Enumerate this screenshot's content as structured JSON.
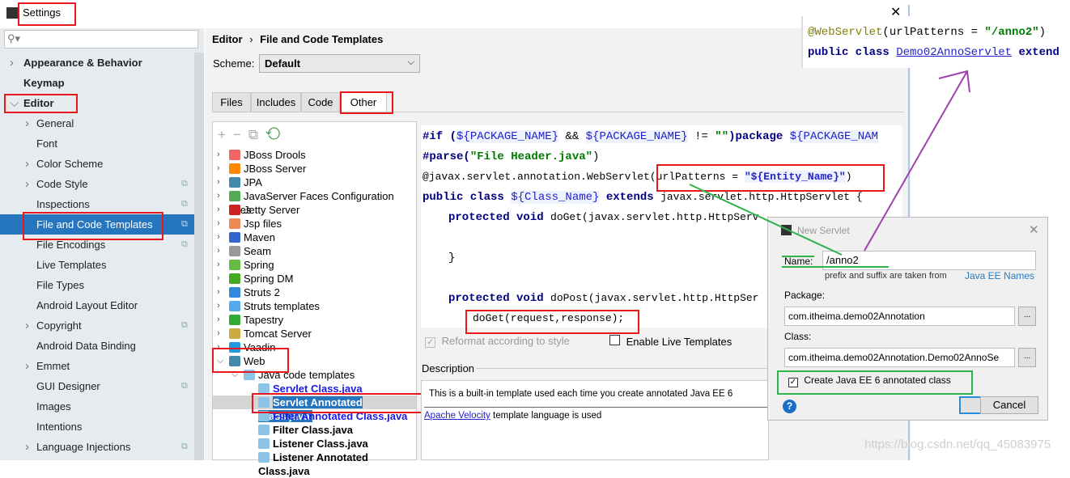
{
  "window": {
    "title": "Settings"
  },
  "sidebar": {
    "search_placeholder": "",
    "items": [
      {
        "label": "Appearance & Behavior",
        "bold": true,
        "chev": ">"
      },
      {
        "label": "Keymap",
        "bold": true,
        "chev": ""
      },
      {
        "label": "Editor",
        "bold": true,
        "chev": "v"
      },
      {
        "label": "General",
        "chev": ">"
      },
      {
        "label": "Font",
        "chev": ""
      },
      {
        "label": "Color Scheme",
        "chev": ">"
      },
      {
        "label": "Code Style",
        "chev": ">",
        "copy": true
      },
      {
        "label": "Inspections",
        "chev": "",
        "copy": true
      },
      {
        "label": "File and Code Templates",
        "chev": "",
        "copy": true,
        "selected": true
      },
      {
        "label": "File Encodings",
        "chev": "",
        "copy": true
      },
      {
        "label": "Live Templates",
        "chev": ""
      },
      {
        "label": "File Types",
        "chev": ""
      },
      {
        "label": "Android Layout Editor",
        "chev": ""
      },
      {
        "label": "Copyright",
        "chev": ">",
        "copy": true
      },
      {
        "label": "Android Data Binding",
        "chev": ""
      },
      {
        "label": "Emmet",
        "chev": ">"
      },
      {
        "label": "GUI Designer",
        "chev": "",
        "copy": true
      },
      {
        "label": "Images",
        "chev": ""
      },
      {
        "label": "Intentions",
        "chev": ""
      },
      {
        "label": "Language Injections",
        "chev": ">",
        "copy": true
      }
    ]
  },
  "breadcrumb": {
    "parent": "Editor",
    "sep": "›",
    "current": "File and Code Templates"
  },
  "scheme": {
    "label": "Scheme:",
    "value": "Default"
  },
  "tabs": [
    "Files",
    "Includes",
    "Code",
    "Other"
  ],
  "tree": {
    "items": [
      {
        "label": "JBoss Drools",
        "color": "#e66"
      },
      {
        "label": "JBoss Server",
        "color": "#f80"
      },
      {
        "label": "JPA",
        "color": "#48a"
      },
      {
        "label": "JavaServer Faces Configuration Files",
        "color": "#5a5"
      },
      {
        "label": "Jetty Server",
        "color": "#c22"
      },
      {
        "label": "Jsp files",
        "color": "#e85"
      },
      {
        "label": "Maven",
        "color": "#36c"
      },
      {
        "label": "Seam",
        "color": "#999"
      },
      {
        "label": "Spring",
        "color": "#6b4"
      },
      {
        "label": "Spring DM",
        "color": "#4a2"
      },
      {
        "label": "Struts 2",
        "color": "#38d"
      },
      {
        "label": "Struts templates",
        "color": "#5ae"
      },
      {
        "label": "Tapestry",
        "color": "#3a3"
      },
      {
        "label": "Tomcat Server",
        "color": "#ca4"
      },
      {
        "label": "Vaadin",
        "color": "#29d"
      },
      {
        "label": "Web",
        "color": "#48a"
      }
    ],
    "group": "Java code templates",
    "templates": [
      {
        "label": "Servlet Class.java",
        "style": "blue"
      },
      {
        "label": "Servlet Annotated Class.java",
        "style": "selected"
      },
      {
        "label": "Filter Annotated Class.java",
        "style": "blue"
      },
      {
        "label": "Filter Class.java",
        "style": "bold"
      },
      {
        "label": "Listener Class.java",
        "style": "bold"
      },
      {
        "label": "Listener Annotated Class.java",
        "style": "bold"
      }
    ]
  },
  "code": {
    "l1a": "#if (",
    "l1b": "${PACKAGE_NAME}",
    "l1c": " && ",
    "l1d": "${PACKAGE_NAME}",
    "l1e": " != ",
    "l1f": "\"\"",
    "l1g": ")package ",
    "l1h": "${PACKAGE_NAM",
    "l2a": "#parse(",
    "l2b": "\"File Header.java\"",
    "l2c": ")",
    "l3a": "@javax.servlet.annotation.WebServlet(urlPatterns = ",
    "l3b": "\"${Entity_Name}\"",
    "l3c": ")",
    "l4a": "public class ",
    "l4b": "${Class_Name}",
    "l4c": " extends ",
    "l4d": "javax.servlet.http.HttpServlet {",
    "l5a": "protected void ",
    "l5b": "doGet(javax.servlet.http.HttpServ",
    "l7": "}",
    "l9a": "protected void ",
    "l9b": "doPost(javax.servlet.http.HttpSer",
    "l10": "doGet(request,response);"
  },
  "options": {
    "reformat": "Reformat according to style",
    "live": "Enable Live Templates"
  },
  "description": {
    "label": "Description",
    "text": "This is a built-in template used each time you create annotated Java EE 6",
    "link": "Apache Velocity",
    "rest": " template language is used"
  },
  "popup": {
    "line1a": "@WebServlet",
    "line1b": "(urlPatterns = ",
    "line1c": "\"/anno2\"",
    "line1d": ")",
    "line2a": "public class ",
    "line2b": "Demo02AnnoServlet",
    "line2c": " extend"
  },
  "dialog": {
    "title": "New Servlet",
    "name_label": "Name:",
    "name_value": "/anno2",
    "hint": "prefix and suffix are taken from",
    "hint_link": "Java EE Names",
    "package_label": "Package:",
    "package_value": "com.itheima.demo02Annotation",
    "class_label": "Class:",
    "class_value": "com.itheima.demo02Annotation.Demo02AnnoSe",
    "browse": "...",
    "checkbox": "Create Java EE 6 annotated class",
    "ok": "OK",
    "cancel": "Cancel",
    "help": "?"
  },
  "watermark": "https://blog.csdn.net/qq_45083975",
  "colors": {
    "selection": "#2675bf",
    "highlight_red": "#e8161d",
    "highlight_green": "#2fb34a",
    "arrow_purple": "#a040b0"
  }
}
